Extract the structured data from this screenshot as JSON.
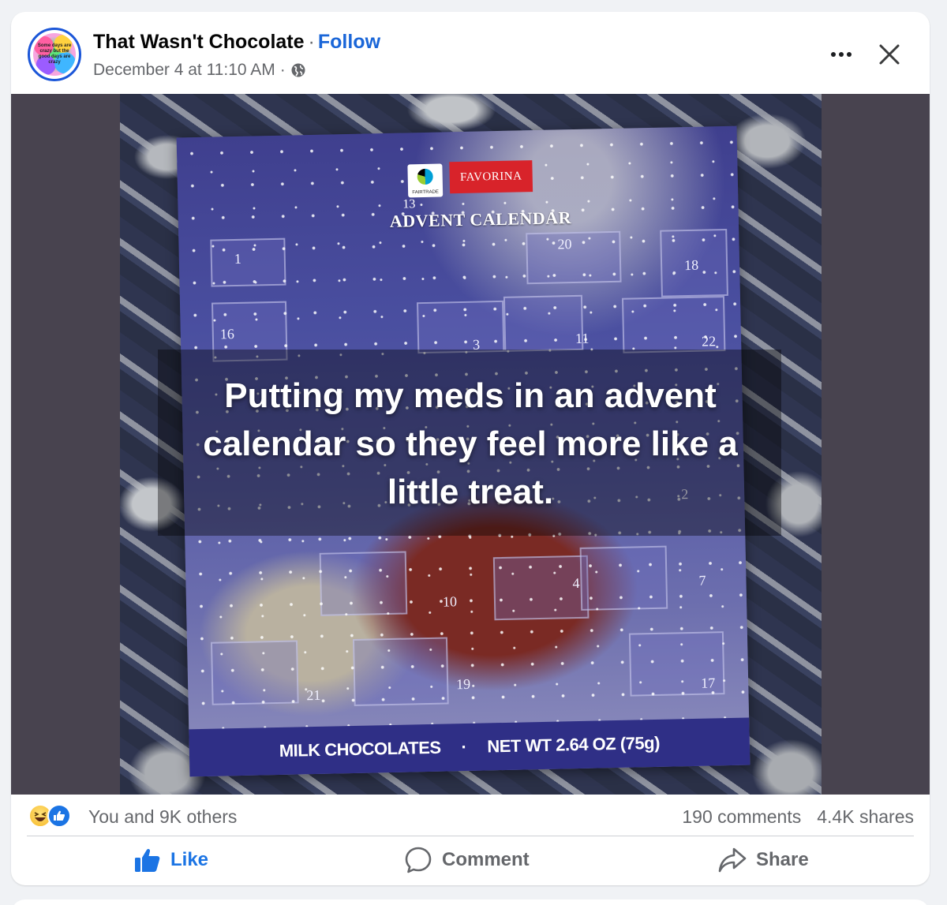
{
  "post": {
    "page_name": "That Wasn't Chocolate",
    "separator": "·",
    "follow_label": "Follow",
    "timestamp": "December 4 at 11:10 AM",
    "meta_separator": "·",
    "privacy_icon": "globe-icon",
    "avatar_text": "Some days are crazy but the good days are crazy",
    "more_icon": "more-options-icon",
    "close_icon": "close-icon"
  },
  "image": {
    "box_brand": "FAVORINA",
    "fairtrade_label": "FAIRTRADE",
    "box_count": "13",
    "box_title": "ADVENT CALENDAR",
    "box_bottom_left": "MILK CHOCOLATES",
    "box_bottom_sep": "·",
    "box_bottom_right": "NET WT 2.64 OZ (75g)",
    "door_numbers": [
      "1",
      "20",
      "18",
      "16",
      "3",
      "11",
      "22",
      "10",
      "4",
      "7",
      "21",
      "19",
      "17",
      "2"
    ],
    "caption_lines": [
      "Putting my meds in an advent",
      "calendar so they feel more like a",
      "little treat."
    ]
  },
  "stats": {
    "reactions_text": "You and 9K others",
    "reaction_icons": [
      "haha-icon",
      "like-icon"
    ],
    "comments": "190 comments",
    "shares": "4.4K shares"
  },
  "actions": {
    "like_label": "Like",
    "comment_label": "Comment",
    "share_label": "Share"
  },
  "colors": {
    "accent": "#1b74e4",
    "follow": "#1a66d8",
    "secondary_text": "#65676b",
    "media_background": "#48434f"
  }
}
